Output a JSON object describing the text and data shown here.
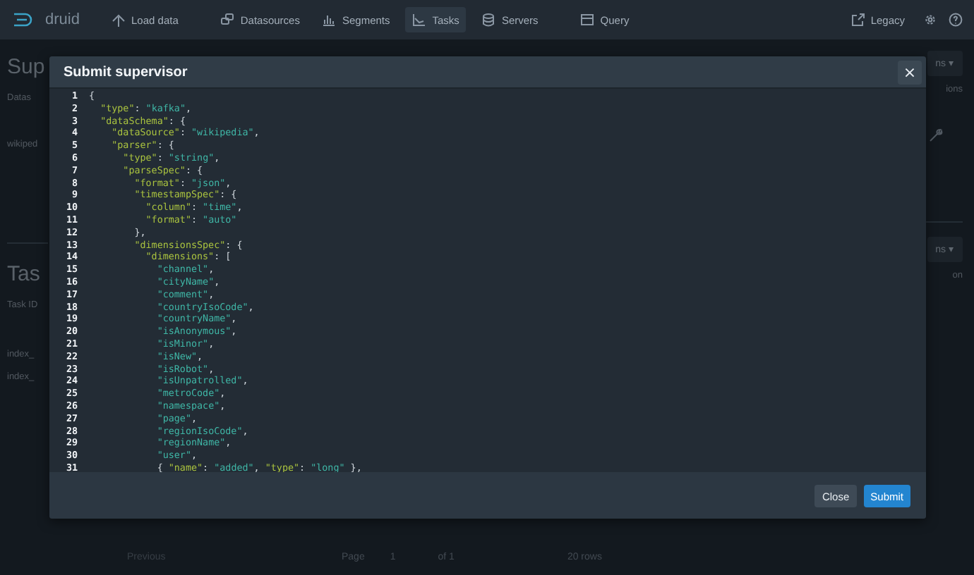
{
  "navbar": {
    "logo": "druid",
    "items": [
      {
        "label": "Load data",
        "selected": false
      },
      {
        "label": "Datasources",
        "selected": false
      },
      {
        "label": "Segments",
        "selected": false
      },
      {
        "label": "Tasks",
        "selected": true
      },
      {
        "label": "Servers",
        "selected": false
      },
      {
        "label": "Query",
        "selected": false
      }
    ],
    "legacy": "Legacy"
  },
  "background": {
    "supervisors_heading": "Sup",
    "supervisors_column": "Datas",
    "supervisors_row": "wikiped",
    "supervisors_actions": "ns ▾",
    "supervisors_actions_column": "ions",
    "tasks_heading": "Tas",
    "tasks_column": "Task ID",
    "tasks_rows": [
      "index_",
      "index_"
    ],
    "tasks_actions": "ns ▾",
    "tasks_actions_column": "on",
    "pagination": {
      "previous": "Previous",
      "page_label": "Page",
      "page": "1",
      "of": "of 1",
      "rows": "20 rows"
    }
  },
  "dialog": {
    "title": "Submit supervisor",
    "close_icon": "×",
    "lines": [
      {
        "number": "1",
        "code": "{"
      },
      {
        "number": "2",
        "code": "  \"type\": \"kafka\","
      },
      {
        "number": "3",
        "code": "  \"dataSchema\": {"
      },
      {
        "number": "4",
        "code": "    \"dataSource\": \"wikipedia\","
      },
      {
        "number": "5",
        "code": "    \"parser\": {"
      },
      {
        "number": "6",
        "code": "      \"type\": \"string\","
      },
      {
        "number": "7",
        "code": "      \"parseSpec\": {"
      },
      {
        "number": "8",
        "code": "        \"format\": \"json\","
      },
      {
        "number": "9",
        "code": "        \"timestampSpec\": {"
      },
      {
        "number": "10",
        "code": "          \"column\": \"time\","
      },
      {
        "number": "11",
        "code": "          \"format\": \"auto\""
      },
      {
        "number": "12",
        "code": "        },"
      },
      {
        "number": "13",
        "code": "        \"dimensionsSpec\": {"
      },
      {
        "number": "14",
        "code": "          \"dimensions\": ["
      },
      {
        "number": "15",
        "code": "            \"channel\","
      },
      {
        "number": "16",
        "code": "            \"cityName\","
      },
      {
        "number": "17",
        "code": "            \"comment\","
      },
      {
        "number": "18",
        "code": "            \"countryIsoCode\","
      },
      {
        "number": "19",
        "code": "            \"countryName\","
      },
      {
        "number": "20",
        "code": "            \"isAnonymous\","
      },
      {
        "number": "21",
        "code": "            \"isMinor\","
      },
      {
        "number": "22",
        "code": "            \"isNew\","
      },
      {
        "number": "23",
        "code": "            \"isRobot\","
      },
      {
        "number": "24",
        "code": "            \"isUnpatrolled\","
      },
      {
        "number": "25",
        "code": "            \"metroCode\","
      },
      {
        "number": "26",
        "code": "            \"namespace\","
      },
      {
        "number": "27",
        "code": "            \"page\","
      },
      {
        "number": "28",
        "code": "            \"regionIsoCode\","
      },
      {
        "number": "29",
        "code": "            \"regionName\","
      },
      {
        "number": "30",
        "code": "            \"user\","
      },
      {
        "number": "31",
        "code": "            { \"name\": \"added\", \"type\": \"long\" },"
      }
    ],
    "buttons": [
      {
        "label": "Close",
        "kind": "secondary"
      },
      {
        "label": "Submit",
        "kind": "primary"
      }
    ]
  }
}
